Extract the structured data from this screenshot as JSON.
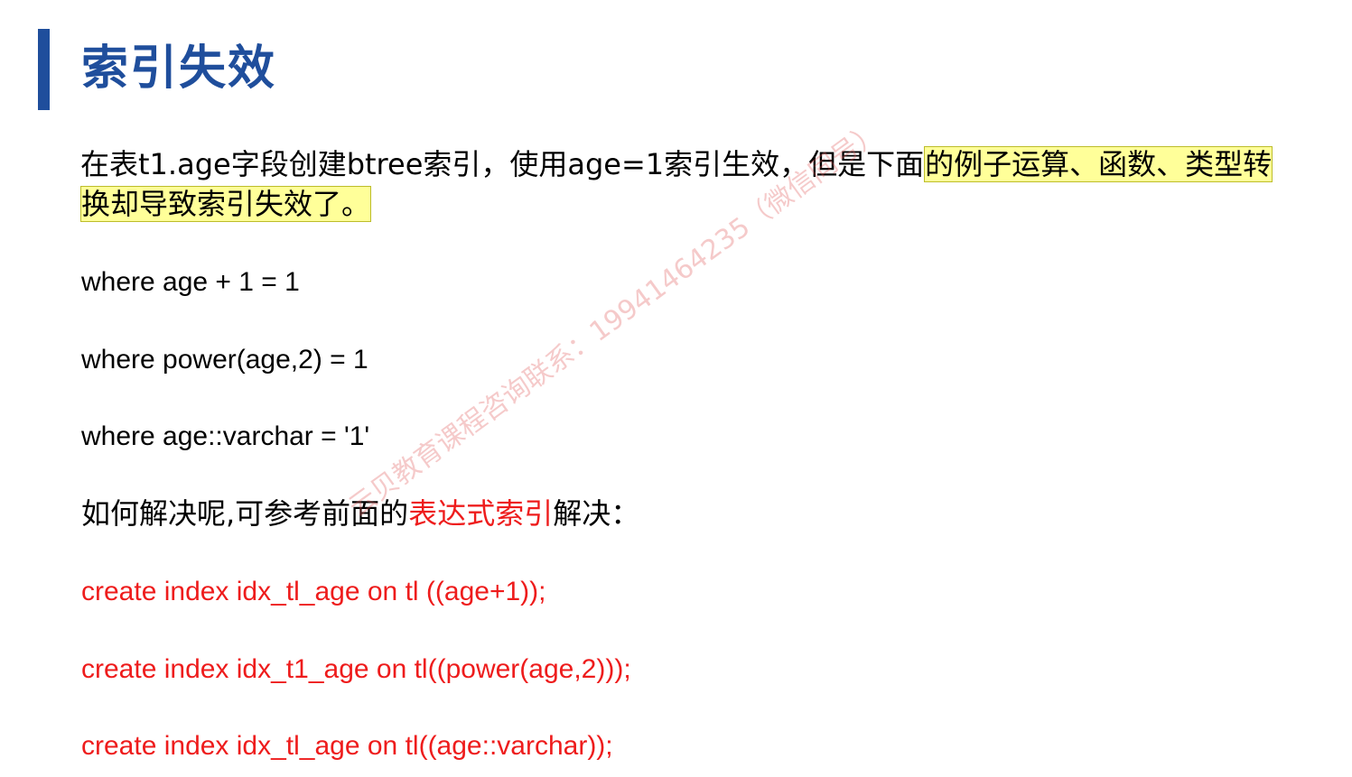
{
  "title": "索引失效",
  "intro": {
    "part1": "在表t1.age字段创建btree索引，使用age=1索引生效，但是下面",
    "highlight": "的例子运算、函数、类型转换却导致索引失效了。"
  },
  "examples": [
    "where age + 1 = 1",
    "where power(age,2) = 1",
    "where age::varchar = '1'"
  ],
  "solution": {
    "prefix": "如何解决呢,可参考前面的",
    "link": "表达式索引",
    "suffix": "解决："
  },
  "code": [
    "create index idx_tl_age on tl ((age+1));",
    "create index idx_t1_age on tl((power(age,2)));",
    "create index idx_tl_age on tl((age::varchar));"
  ],
  "watermark": "云贝教育课程咨询联系：19941464235（微信同号）",
  "colors": {
    "accent": "#1f4e9c",
    "highlight": "#ffff99",
    "code": "#ee1c1c"
  }
}
